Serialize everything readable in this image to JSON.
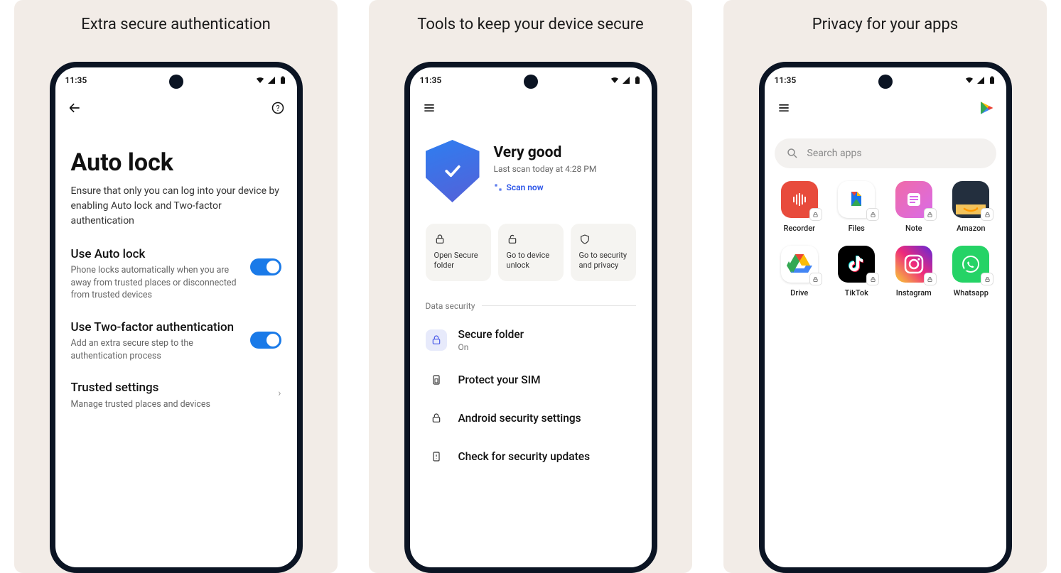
{
  "statusTime": "11:35",
  "panel1": {
    "caption": "Extra secure authentication",
    "title": "Auto lock",
    "subtitle": "Ensure that only you can log into your device by enabling Auto lock and Two-factor authentication",
    "settings": [
      {
        "title": "Use Auto lock",
        "desc": "Phone locks automatically when you are away from trusted places or disconnected from trusted devices",
        "toggle": true
      },
      {
        "title": "Use Two-factor authentication",
        "desc": "Add an extra secure step to the authentication process",
        "toggle": true
      }
    ],
    "trusted": {
      "title": "Trusted settings",
      "desc": "Manage trusted places and devices"
    }
  },
  "panel2": {
    "caption": "Tools to keep your device secure",
    "hero": {
      "title": "Very good",
      "sub": "Last scan today at 4:28 PM",
      "scan": "Scan now"
    },
    "cards": [
      {
        "label": "Open Secure folder"
      },
      {
        "label": "Go to device unlock"
      },
      {
        "label": "Go to security and privacy"
      }
    ],
    "sectionLabel": "Data security",
    "list": [
      {
        "title": "Secure folder",
        "sub": "On",
        "highlight": true,
        "icon": "lock"
      },
      {
        "title": "Protect your SIM",
        "icon": "sim"
      },
      {
        "title": "Android security settings",
        "icon": "padlock"
      },
      {
        "title": "Check for security updates",
        "icon": "phone"
      }
    ]
  },
  "panel3": {
    "caption": "Privacy for your apps",
    "searchPlaceholder": "Search apps",
    "apps": [
      {
        "name": "Recorder",
        "bg": "#e84b3c",
        "iconType": "recorder"
      },
      {
        "name": "Files",
        "bg": "#ffffff",
        "iconType": "files"
      },
      {
        "name": "Note",
        "bg": "linear-gradient(135deg,#f06ba8,#d96be8)",
        "iconType": "note"
      },
      {
        "name": "Amazon",
        "bg": "#232f3e",
        "iconType": "amazon"
      },
      {
        "name": "Drive",
        "bg": "#ffffff",
        "iconType": "drive"
      },
      {
        "name": "TikTok",
        "bg": "#000000",
        "iconType": "tiktok"
      },
      {
        "name": "Instagram",
        "bg": "linear-gradient(45deg,#f9ce34,#ee2a7b,#6228d7)",
        "iconType": "instagram"
      },
      {
        "name": "Whatsapp",
        "bg": "#25d366",
        "iconType": "whatsapp"
      }
    ]
  }
}
